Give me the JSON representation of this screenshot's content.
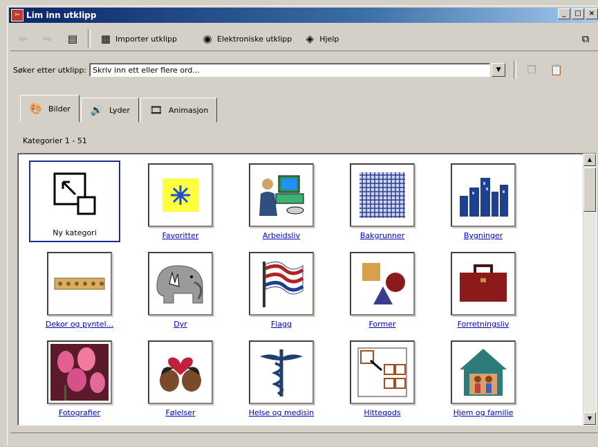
{
  "window": {
    "title": "Lim inn utklipp"
  },
  "toolbar": {
    "import_label": "Importer utklipp",
    "online_label": "Elektroniske utklipp",
    "help_label": "Hjelp"
  },
  "search": {
    "label": "Søker etter utklipp:",
    "placeholder": "Skriv inn ett eller flere ord..."
  },
  "tabs": [
    {
      "label": "Bilder"
    },
    {
      "label": "Lyder"
    },
    {
      "label": "Animasjon"
    }
  ],
  "category_count": "Kategorier 1 - 51",
  "categories": [
    {
      "label": "Ny kategori",
      "icon": "new-category-icon"
    },
    {
      "label": "Favoritter",
      "icon": "star-icon"
    },
    {
      "label": "Arbeidsliv",
      "icon": "computer-user-icon"
    },
    {
      "label": "Bakgrunner",
      "icon": "grid-pattern-icon"
    },
    {
      "label": "Bygninger",
      "icon": "skyline-icon"
    },
    {
      "label": "Dekor og pyntel...",
      "icon": "ribbon-icon"
    },
    {
      "label": "Dyr",
      "icon": "elephant-icon"
    },
    {
      "label": "Flagg",
      "icon": "flag-icon"
    },
    {
      "label": "Former",
      "icon": "shapes-icon"
    },
    {
      "label": "Forretningsliv",
      "icon": "briefcase-icon"
    },
    {
      "label": "Fotografier",
      "icon": "tulips-photo-icon"
    },
    {
      "label": "Følelser",
      "icon": "couple-heart-icon"
    },
    {
      "label": "Helse og medisin",
      "icon": "caduceus-icon"
    },
    {
      "label": "Hitteqods",
      "icon": "boxes-icon"
    },
    {
      "label": "Hjem og familie",
      "icon": "house-family-icon"
    }
  ],
  "colors": {
    "titlebar": "#0a246a",
    "link": "#0000c0",
    "selection": "#1d2c8a"
  }
}
